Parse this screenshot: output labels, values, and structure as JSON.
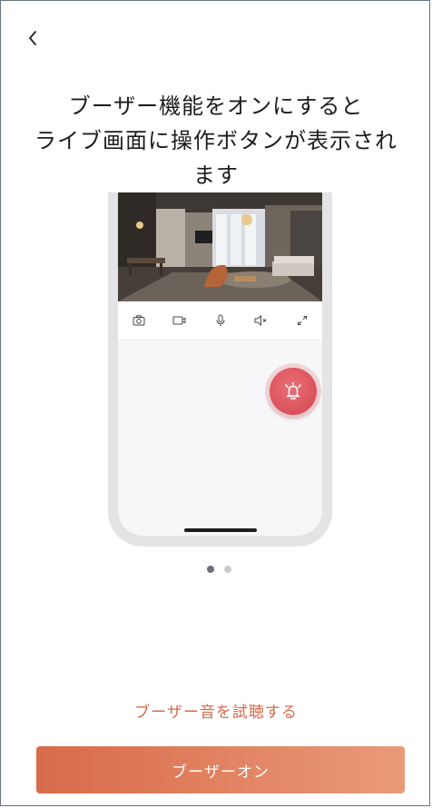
{
  "header": {
    "back_icon": "chevron-left-icon"
  },
  "intro": {
    "title_line1": "ブーザー機能をオンにすると",
    "title_line2": "ライブ画面に操作ボタンが表示され",
    "title_line3": "ます"
  },
  "preview": {
    "toolbar_icons": [
      "camera-icon",
      "record-video-icon",
      "microphone-icon",
      "speaker-mute-icon",
      "fullscreen-icon"
    ],
    "buzzer_icon": "alarm-bell-icon"
  },
  "pager": {
    "total": 2,
    "active_index": 0
  },
  "actions": {
    "try_sound_label": "ブーザー音を試聴する",
    "enable_label": "ブーザーオン"
  },
  "colors": {
    "accent": "#d86a4a",
    "accent_end": "#ea9a78",
    "buzzer": "#d3444f"
  }
}
